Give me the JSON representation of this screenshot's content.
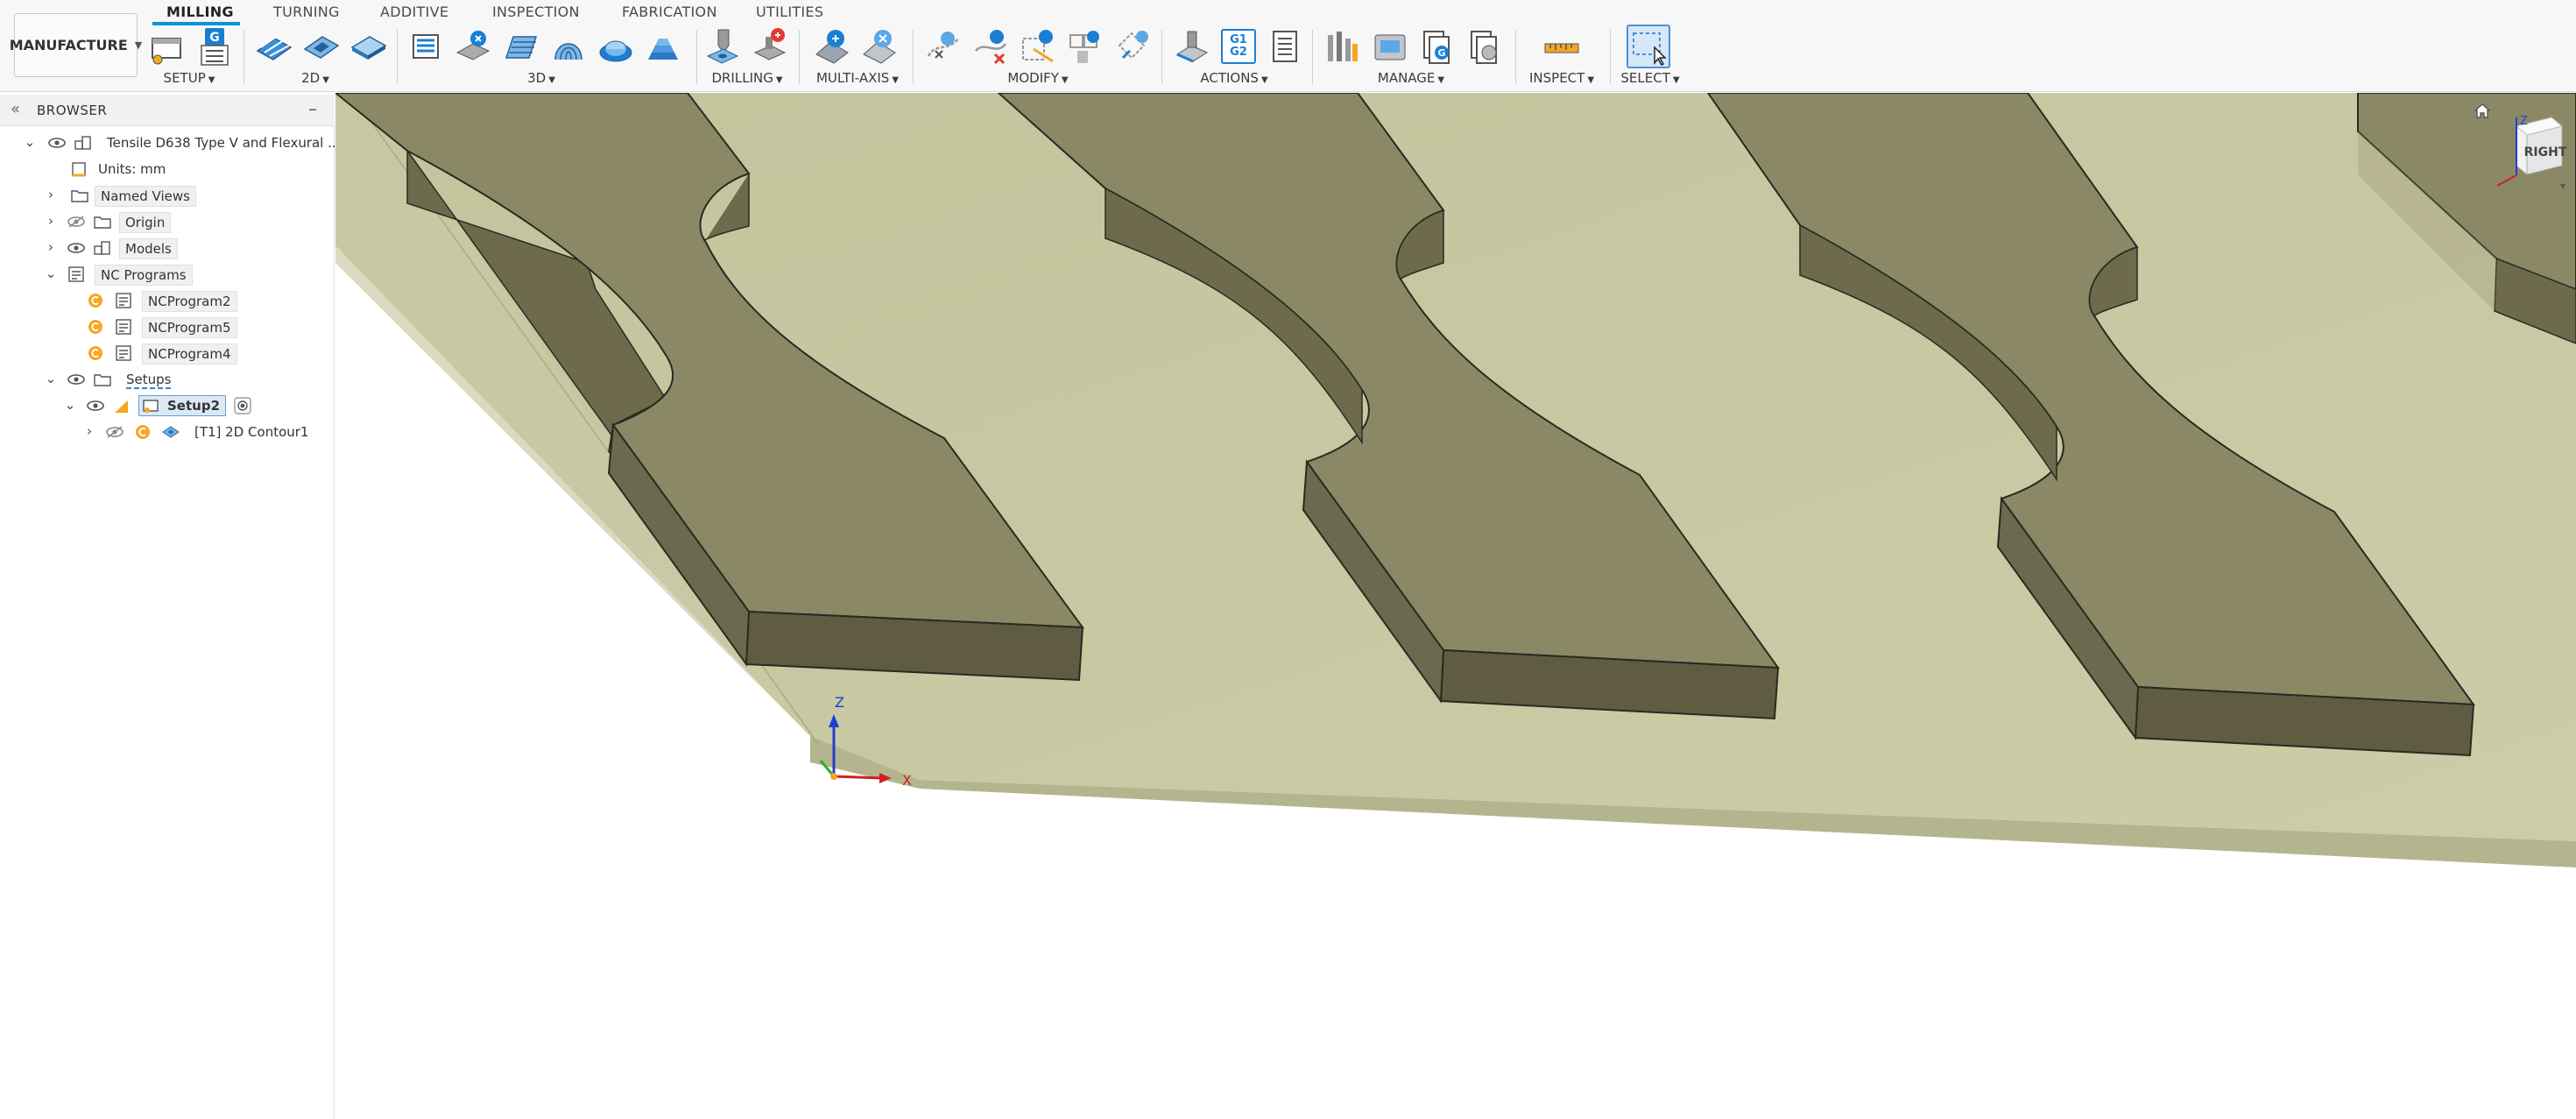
{
  "toolbar": {
    "workspace": "MANUFACTURE",
    "tabs": [
      "MILLING",
      "TURNING",
      "ADDITIVE",
      "INSPECTION",
      "FABRICATION",
      "UTILITIES"
    ],
    "active_tab": "MILLING",
    "groups": {
      "setup": "SETUP",
      "two_d": "2D",
      "three_d": "3D",
      "drilling": "DRILLING",
      "multi_axis": "MULTI-AXIS",
      "modify": "MODIFY",
      "actions": "ACTIONS",
      "manage": "MANAGE",
      "inspect": "INSPECT",
      "select": "SELECT"
    },
    "actions_g1g2": "G1\nG2"
  },
  "browser": {
    "title": "BROWSER",
    "root": "Tensile D638 Type V and Flexural ...",
    "units": "Units: mm",
    "named_views": "Named Views",
    "origin": "Origin",
    "models": "Models",
    "nc_programs": "NC Programs",
    "programs": [
      "NCProgram2",
      "NCProgram5",
      "NCProgram4"
    ],
    "setups": "Setups",
    "setup": "Setup2",
    "operation": "[T1] 2D Contour1"
  },
  "viewport": {
    "view_cube_face": "RIGHT",
    "axis_z": "Z",
    "axis_x": "X",
    "cube_axis_z": "Z"
  },
  "colors": {
    "accent": "#0696d7",
    "stock": "#c6c7a0",
    "part_top": "#8b8866",
    "part_side": "#6c6a4e",
    "op_orange": "#f5a623"
  }
}
